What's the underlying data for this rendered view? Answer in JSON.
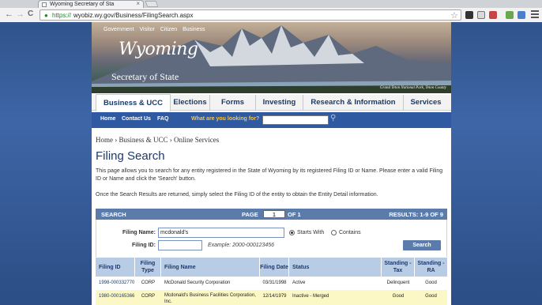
{
  "browser": {
    "tab_title": "Wyoming Secretary of Sta",
    "tab_close": "×",
    "url_scheme": "https://",
    "url_rest": "wyobiz.wy.gov/Business/FilingSearch.aspx",
    "star": "☆",
    "back": "←",
    "forward": "→",
    "reload": "C",
    "lock": "🔒"
  },
  "banner": {
    "top_links": [
      "Government",
      "Visitor",
      "Citizen",
      "Business"
    ],
    "logo_word": "Wyoming",
    "logo_sub": "Secretary of State",
    "photo_credit": "Grand Teton National Park, Teton County"
  },
  "main_nav": [
    "Business & UCC",
    "Elections",
    "Forms",
    "Investing",
    "Research & Information",
    "Services"
  ],
  "sub_nav": {
    "links": [
      "Home",
      "Contact Us",
      "FAQ"
    ],
    "search_label": "What are you looking for?",
    "search_value": ""
  },
  "breadcrumb": "Home › Business & UCC › Online Services",
  "page_title": "Filing Search",
  "intro": "This page allows you to search for any entity registered in the State of Wyoming by its registered Filing ID or Name. Please enter a valid Filing ID or Name and click the 'Search' button.",
  "intro2": "Once the Search Results are returned, simply select the Filing ID of the entity to obtain the Entity Detail information.",
  "search_bar": {
    "label": "SEARCH",
    "page_label": "PAGE",
    "page_value": "1",
    "of_label": "OF 1",
    "results": "RESULTS: 1-9 OF 9"
  },
  "form": {
    "name_label": "Filing Name:",
    "name_value": "mcdonald's",
    "starts_with": "Starts With",
    "contains": "Contains",
    "id_label": "Filing ID:",
    "id_value": "",
    "example": "Example: 2000-000123456",
    "search_button": "Search"
  },
  "table": {
    "headers": [
      "Filing ID",
      "Filing Type",
      "Filing Name",
      "Filing Date",
      "Status",
      "Standing - Tax",
      "Standing - RA"
    ],
    "rows": [
      [
        "1998-000332770",
        "CORP",
        "McDonald Security Corporation",
        "03/31/1998",
        "Active",
        "Delinquent",
        "Good"
      ],
      [
        "1980-000165366",
        "CORP",
        "Mcdonald's Business Facilities Corporation, Inc.",
        "12/14/1979",
        "Inactive - Merged",
        "Good",
        "Good"
      ]
    ]
  }
}
